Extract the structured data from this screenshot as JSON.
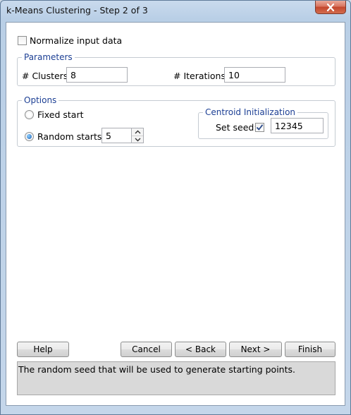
{
  "window": {
    "title": "k-Means Clustering - Step 2 of 3"
  },
  "normalize": {
    "label": "Normalize input data",
    "checked": false
  },
  "parameters": {
    "legend": "Parameters",
    "clusters_label": "# Clusters:",
    "clusters_value": "8",
    "iterations_label": "# Iterations:",
    "iterations_value": "10"
  },
  "options": {
    "legend": "Options",
    "fixed_start_label": "Fixed start",
    "random_starts_label": "Random starts:",
    "random_starts_value": "5",
    "selected": "Random starts",
    "centroid": {
      "legend": "Centroid Initialization",
      "set_seed_label": "Set seed:",
      "set_seed_checked": true,
      "seed_value": "12345"
    }
  },
  "buttons": {
    "help": "Help",
    "cancel": "Cancel",
    "back": "< Back",
    "next": "Next >",
    "finish": "Finish"
  },
  "status": {
    "text": "The random seed that will be used to generate starting points."
  },
  "colors": {
    "legend": "#1c3f94",
    "close": "#c3462c",
    "check": "#2a4a8a"
  }
}
